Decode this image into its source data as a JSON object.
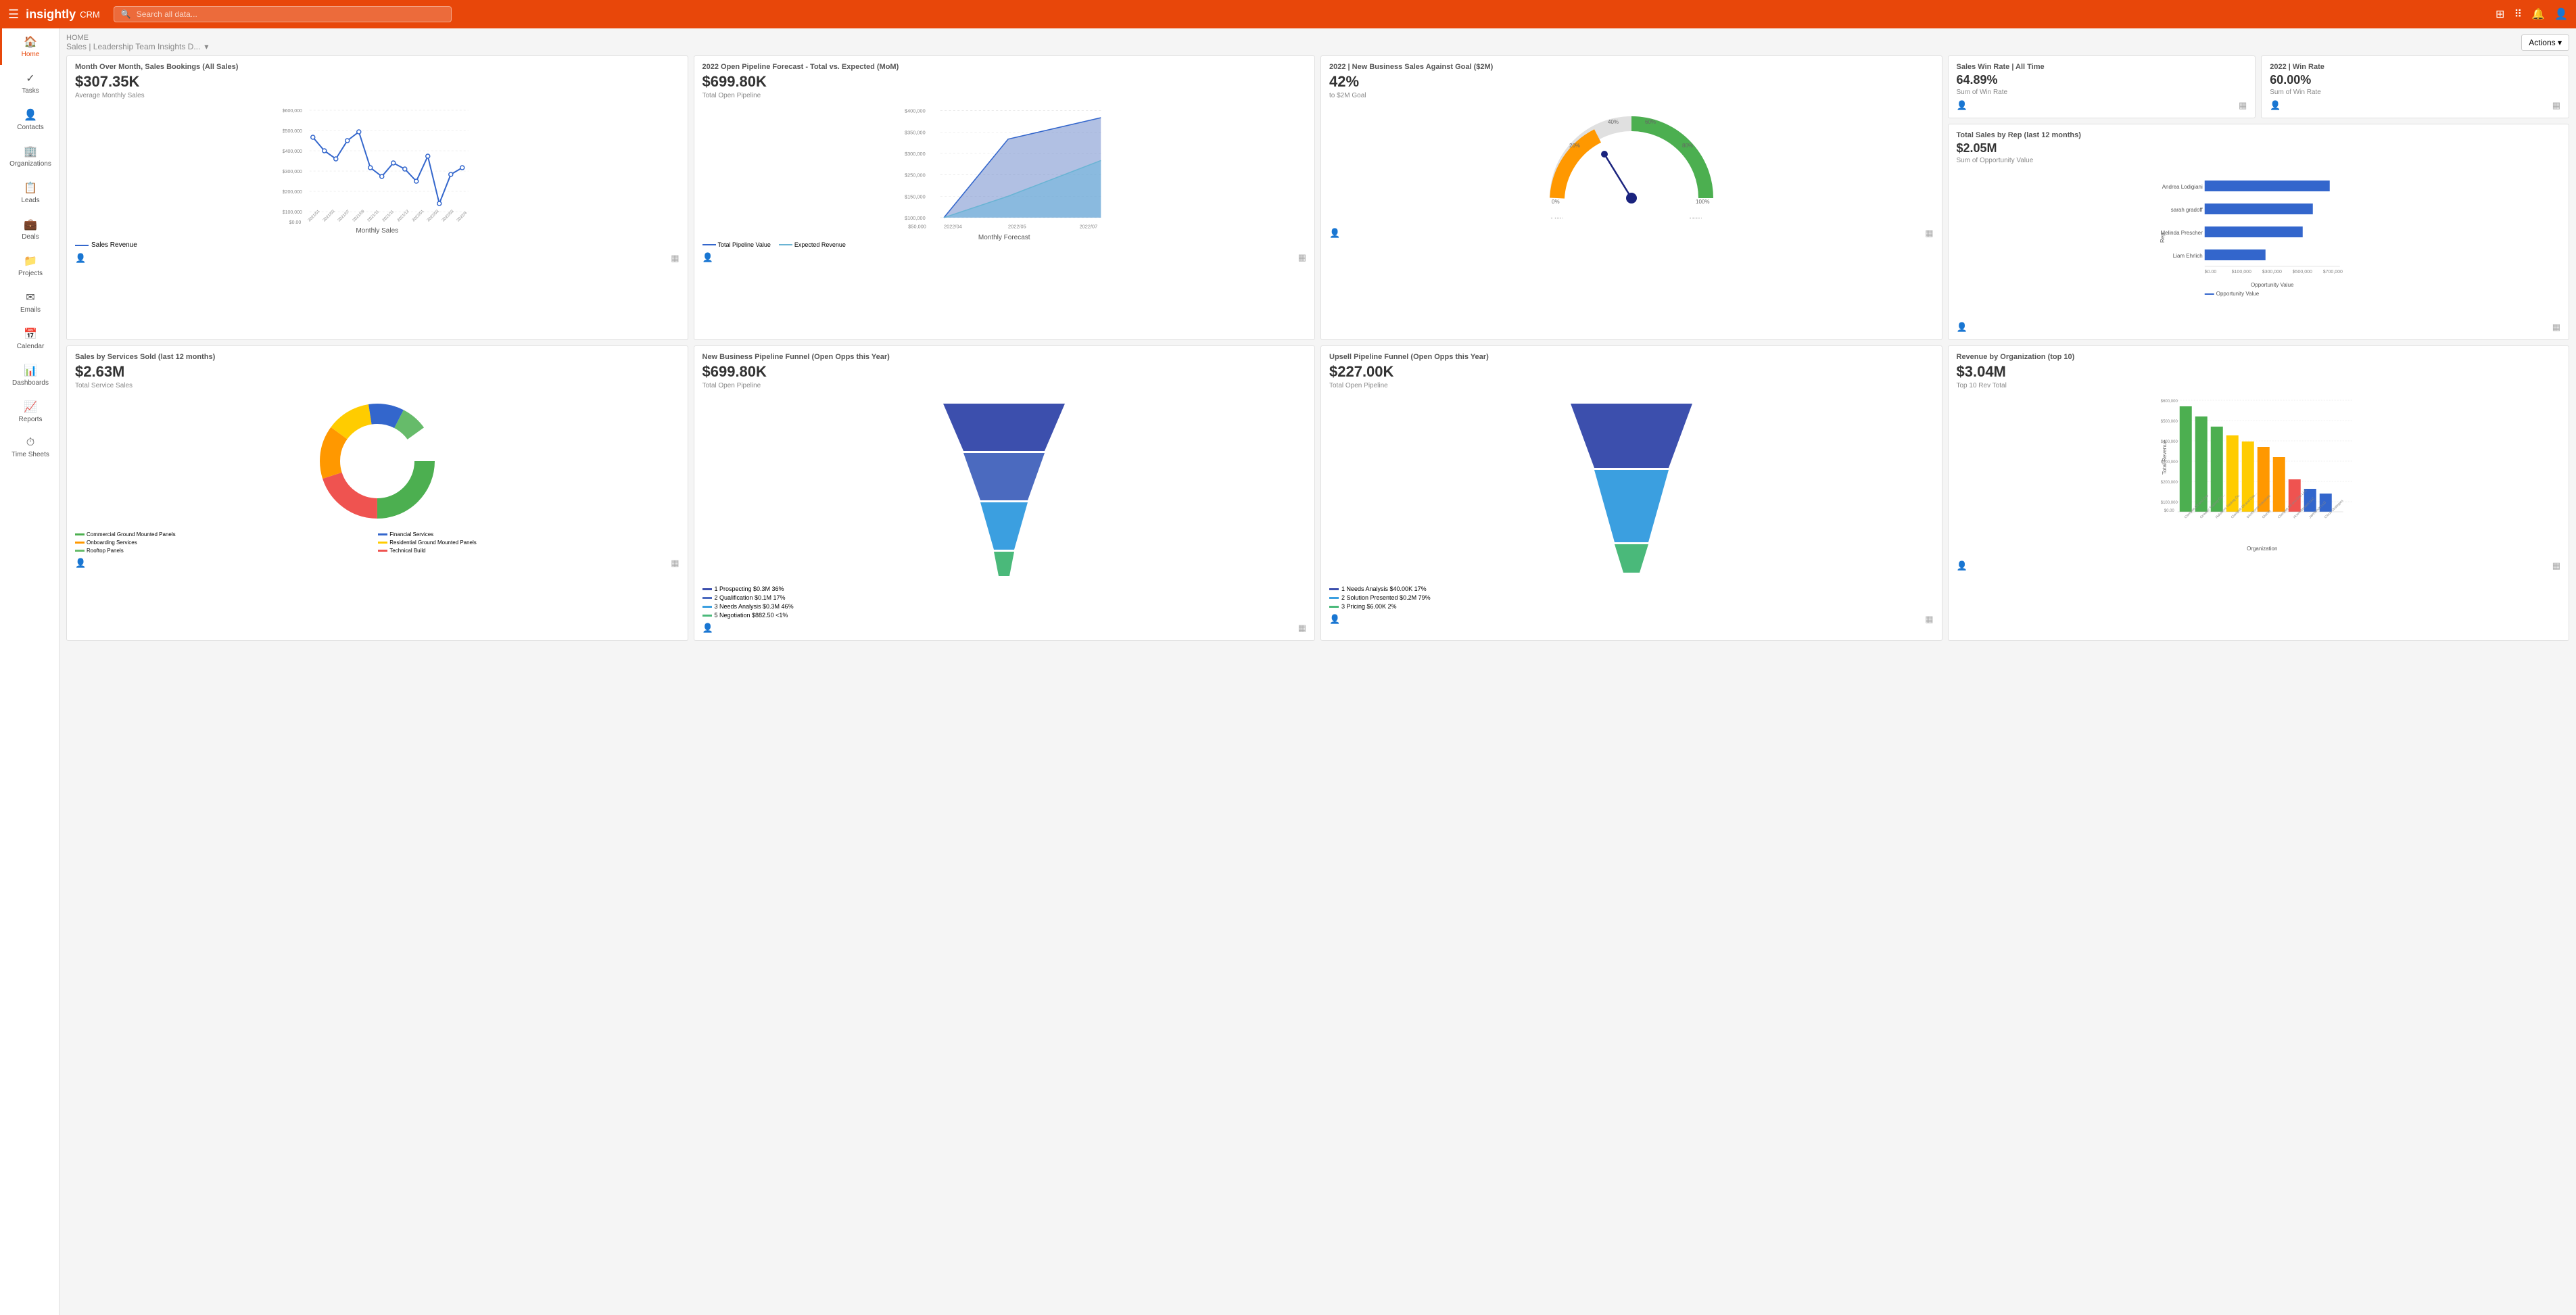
{
  "topNav": {
    "logoText": "insightly",
    "crmLabel": "CRM",
    "searchPlaceholder": "Search all data...",
    "hamburgerIcon": "☰",
    "gridIcon": "⊞",
    "appsIcon": "⋮⋮",
    "bellIcon": "🔔",
    "userIcon": "👤"
  },
  "breadcrumb": {
    "home": "HOME",
    "title": "Sales | Leadership Team Insights D...",
    "chevron": "▾"
  },
  "actionsButton": "Actions ▾",
  "sidebar": {
    "items": [
      {
        "label": "Home",
        "icon": "🏠",
        "active": true
      },
      {
        "label": "Tasks",
        "icon": "✓"
      },
      {
        "label": "Contacts",
        "icon": "👤"
      },
      {
        "label": "Organizations",
        "icon": "🏢"
      },
      {
        "label": "Leads",
        "icon": "📋"
      },
      {
        "label": "Deals",
        "icon": "💼"
      },
      {
        "label": "Projects",
        "icon": "📁"
      },
      {
        "label": "Emails",
        "icon": "✉"
      },
      {
        "label": "Calendar",
        "icon": "📅"
      },
      {
        "label": "Dashboards",
        "icon": "📊"
      },
      {
        "label": "Reports",
        "icon": "📈"
      },
      {
        "label": "Time Sheets",
        "icon": "⏱"
      }
    ]
  },
  "cards": {
    "monthOverMonth": {
      "title": "Month Over Month, Sales Bookings (All Sales)",
      "value": "$307.35K",
      "subtitle": "Average Monthly Sales",
      "legend": "Sales Revenue",
      "xLabel": "Monthly Sales",
      "data": [
        480000,
        420000,
        390000,
        450000,
        500000,
        320000,
        280000,
        350000,
        310000,
        270000,
        380000,
        180000,
        280000,
        310000
      ]
    },
    "openPipeline": {
      "title": "2022 Open Pipeline Forecast - Total vs. Expected (MoM)",
      "value": "$699.80K",
      "subtitle": "Total Open Pipeline",
      "legend1": "Total Pipeline Value",
      "legend2": "Expected Revenue",
      "xLabel": "Monthly Forecast"
    },
    "newBusiness": {
      "title": "2022 | New Business Sales Against Goal ($2M)",
      "value": "42%",
      "subtitle": "to $2M Goal"
    },
    "salesWinRateAll": {
      "title": "Sales Win Rate | All Time",
      "value": "64.89%",
      "subtitle": "Sum of Win Rate"
    },
    "salesWinRate2022": {
      "title": "2022 | Win Rate",
      "value": "60.00%",
      "subtitle": "Sum of Win Rate"
    },
    "totalSalesByRep": {
      "title": "Total Sales by Rep (last 12 months)",
      "value": "$2.05M",
      "subtitle": "Sum of Opportunity Value",
      "legend": "Opportunity Value",
      "reps": [
        {
          "name": "Andrea Lodigiani",
          "value": 700000
        },
        {
          "name": "sarah gradoff",
          "value": 600000
        },
        {
          "name": "Melinda Prescher",
          "value": 550000
        },
        {
          "name": "Liam Ehrlich",
          "value": 350000
        }
      ],
      "xAxisLabel": "Opportunity Value"
    },
    "salesByServices": {
      "title": "Sales by Services Sold (last 12 months)",
      "value": "$2.63M",
      "subtitle": "Total Service Sales",
      "legends": [
        {
          "label": "Commercial Ground Mounted Panels",
          "color": "#4caf50"
        },
        {
          "label": "Financial Services",
          "color": "#3366cc"
        },
        {
          "label": "Onboarding Services",
          "color": "#ff9800"
        },
        {
          "label": "Residential Ground Mounted Panels",
          "color": "#ffcc00"
        },
        {
          "label": "Rooftop Panels",
          "color": "#66bb6a"
        },
        {
          "label": "Technical Build",
          "color": "#ef5350"
        }
      ]
    },
    "newBizFunnel": {
      "title": "New Business Pipeline Funnel (Open Opps this Year)",
      "value": "$699.80K",
      "subtitle": "Total Open Pipeline",
      "stages": [
        {
          "label": "1 Prospecting",
          "value": "$0.3M",
          "pct": "36%",
          "color": "#3c4fad"
        },
        {
          "label": "2 Qualification",
          "value": "$0.1M",
          "pct": "17%",
          "color": "#4b6abf"
        },
        {
          "label": "3 Needs Analysis",
          "value": "$0.3M",
          "pct": "46%",
          "color": "#3b9fe0"
        },
        {
          "label": "5 Negotiation",
          "value": "$882.50",
          "pct": "<1%",
          "color": "#4ab97a"
        }
      ]
    },
    "upsellFunnel": {
      "title": "Upsell Pipeline Funnel (Open Opps this Year)",
      "value": "$227.00K",
      "subtitle": "Total Open Pipeline",
      "stages": [
        {
          "label": "1 Needs Analysis",
          "value": "$40.00K",
          "pct": "17%",
          "color": "#3c4fad"
        },
        {
          "label": "2 Solution Presented",
          "value": "$0.2M",
          "pct": "79%",
          "color": "#3b9fe0"
        },
        {
          "label": "3 Pricing",
          "value": "$6.00K",
          "pct": "2%",
          "color": "#4ab97a"
        }
      ]
    },
    "revenueByOrg": {
      "title": "Revenue by Organization (top 10)",
      "value": "$3.04M",
      "subtitle": "Top 10 Rev Total",
      "orgs": [
        {
          "name": "Clampett Oil and Gas",
          "value": 550000,
          "color": "#4caf50"
        },
        {
          "name": "Oceanic Trading Car...",
          "value": 480000,
          "color": "#4caf50"
        },
        {
          "name": "Nakatomi Trading Co.",
          "value": 420000,
          "color": "#4caf50"
        },
        {
          "name": "Clampett Oil and Gas...",
          "value": 380000,
          "color": "#4caf50"
        },
        {
          "name": "Workhorse Industries",
          "value": 350000,
          "color": "#ffcc00"
        },
        {
          "name": "Globex",
          "value": 320000,
          "color": "#ffcc00"
        },
        {
          "name": "Clampett Oil and Gas LLC",
          "value": 290000,
          "color": "#ff9800"
        },
        {
          "name": "Howe-Benson LLC",
          "value": 160000,
          "color": "#ef5350"
        },
        {
          "name": "JakWoods LLC",
          "value": 110000,
          "color": "#3366cc"
        },
        {
          "name": "Citrus Strategies",
          "value": 90000,
          "color": "#3366cc"
        }
      ],
      "xAxisLabel": "Organization",
      "yAxisLabel": "Total Revenue"
    }
  }
}
